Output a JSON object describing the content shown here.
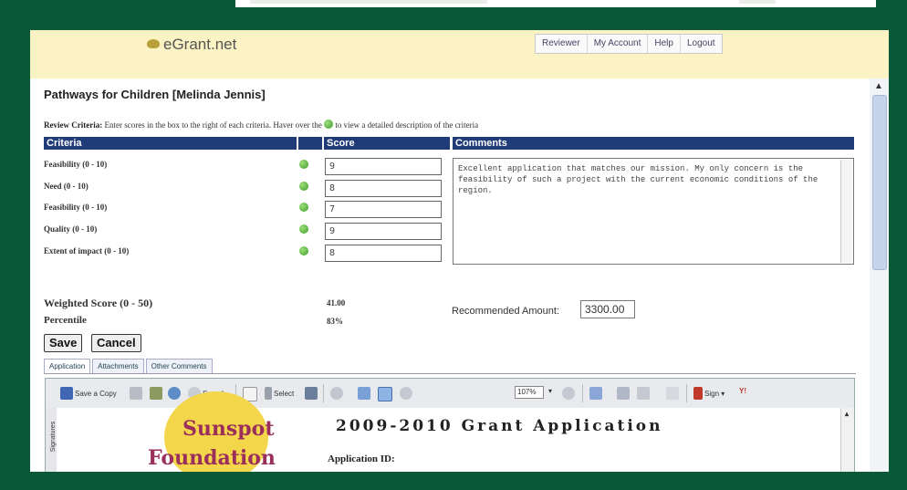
{
  "app": {
    "logo": "eGrant.net"
  },
  "nav": [
    "Reviewer",
    "My Account",
    "Help",
    "Logout"
  ],
  "page_title": "Pathways for Children [Melinda Jennis]",
  "instructions": {
    "label": "Review Criteria:",
    "text_before": " Enter scores in the box to the right of each criteria. Haver over the ",
    "text_after": " to view a detailed description of the criteria"
  },
  "table_headers": {
    "criteria": "Criteria",
    "score": "Score",
    "comments": "Comments"
  },
  "criteria": [
    {
      "label": "Feasibility (0 - 10)",
      "score": "9"
    },
    {
      "label": "Need (0 - 10)",
      "score": "8"
    },
    {
      "label": "Feasibility (0 - 10)",
      "score": "7"
    },
    {
      "label": "Quality (0 - 10)",
      "score": "9"
    },
    {
      "label": "Extent of impact (0 - 10)",
      "score": "8"
    }
  ],
  "comments_text": "Excellent application that matches our mission. My only concern is the feasibility of such a project with the current economic conditions of the region.",
  "weighted_score": {
    "label": "Weighted Score (0 - 50)",
    "value": "41.00"
  },
  "percentile": {
    "label": "Percentile",
    "value": "83%"
  },
  "recommended_amount": {
    "label": "Recommended Amount:",
    "value": "3300.00"
  },
  "buttons": {
    "save": "Save",
    "cancel": "Cancel"
  },
  "tabs": [
    "Application",
    "Attachments",
    "Other Comments"
  ],
  "viewer": {
    "toolbar": {
      "save_copy": "Save a Copy",
      "search": "Search",
      "select": "Select",
      "zoom": "107%",
      "sign": "Sign"
    },
    "sidebar_label": "Signatures",
    "doc_logo_line1": "Sunspot",
    "doc_logo_line2": "Foundation",
    "doc_title": "2009-2010 Grant Application",
    "doc_appid": "Application ID:"
  },
  "colors": {
    "frame": "#0a5a3a",
    "header_bg": "#fbf3c4",
    "table_header": "#1f3b78"
  }
}
